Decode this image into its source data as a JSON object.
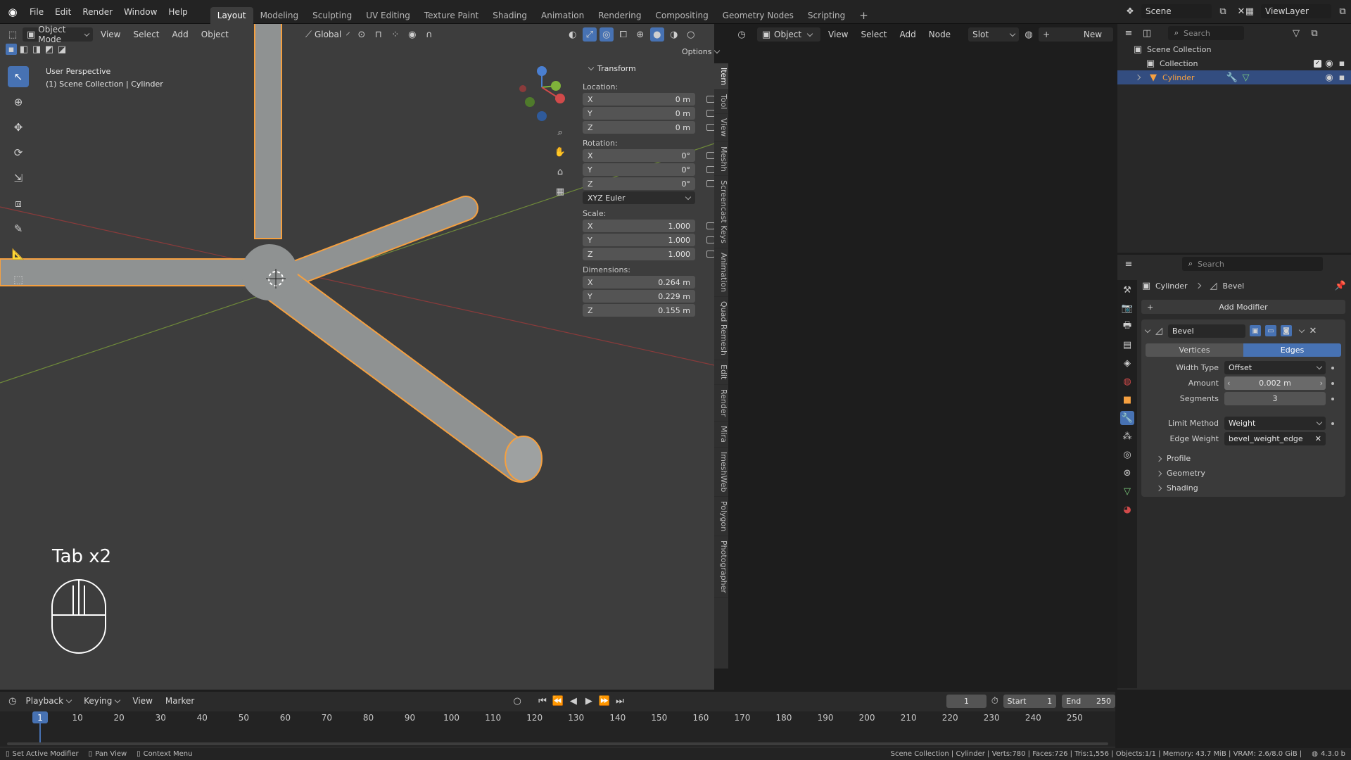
{
  "topbar": {
    "menus": [
      "File",
      "Edit",
      "Render",
      "Window",
      "Help"
    ],
    "workspaces": [
      "Layout",
      "Modeling",
      "Sculpting",
      "UV Editing",
      "Texture Paint",
      "Shading",
      "Animation",
      "Rendering",
      "Compositing",
      "Geometry Nodes",
      "Scripting"
    ],
    "active_workspace": "Layout",
    "scene": "Scene",
    "view_layer": "ViewLayer"
  },
  "viewport": {
    "mode": "Object Mode",
    "menus": [
      "View",
      "Select",
      "Add",
      "Object"
    ],
    "orientation": "Global",
    "options_label": "Options",
    "perspective_label": "User Perspective",
    "collection_label": "(1) Scene Collection | Cylinder",
    "key_hint": "Tab x2"
  },
  "npanel": {
    "section": "Transform",
    "location_label": "Location:",
    "location": [
      {
        "axis": "X",
        "value": "0 m"
      },
      {
        "axis": "Y",
        "value": "0 m"
      },
      {
        "axis": "Z",
        "value": "0 m"
      }
    ],
    "rotation_label": "Rotation:",
    "rotation": [
      {
        "axis": "X",
        "value": "0°"
      },
      {
        "axis": "Y",
        "value": "0°"
      },
      {
        "axis": "Z",
        "value": "0°"
      }
    ],
    "rotation_mode": "XYZ Euler",
    "scale_label": "Scale:",
    "scale": [
      {
        "axis": "X",
        "value": "1.000"
      },
      {
        "axis": "Y",
        "value": "1.000"
      },
      {
        "axis": "Z",
        "value": "1.000"
      }
    ],
    "dimensions_label": "Dimensions:",
    "dimensions": [
      {
        "axis": "X",
        "value": "0.264 m"
      },
      {
        "axis": "Y",
        "value": "0.229 m"
      },
      {
        "axis": "Z",
        "value": "0.155 m"
      }
    ],
    "tabs": [
      "Item",
      "Tool",
      "View",
      "Meshh",
      "Screencast Keys",
      "Animation",
      "Quad Remesh",
      "Edit",
      "Render",
      "Mira",
      "ImeshWeb",
      "Polygon",
      "Photographer"
    ]
  },
  "node_editor": {
    "type": "Object",
    "menus": [
      "View",
      "Select",
      "Add",
      "Node"
    ],
    "slot": "Slot",
    "new_label": "New"
  },
  "outliner": {
    "search_placeholder": "Search",
    "root": "Scene Collection",
    "collection": "Collection",
    "object": "Cylinder"
  },
  "properties": {
    "search_placeholder": "Search",
    "breadcrumb_object": "Cylinder",
    "breadcrumb_modifier": "Bevel",
    "add_modifier": "Add Modifier",
    "modifier_name": "Bevel",
    "affect_vertices": "Vertices",
    "affect_edges": "Edges",
    "width_type_label": "Width Type",
    "width_type": "Offset",
    "amount_label": "Amount",
    "amount": "0.002 m",
    "segments_label": "Segments",
    "segments": "3",
    "limit_method_label": "Limit Method",
    "limit_method": "Weight",
    "edge_weight_label": "Edge Weight",
    "edge_weight": "bevel_weight_edge",
    "subpanels": [
      "Profile",
      "Geometry",
      "Shading"
    ]
  },
  "timeline": {
    "menus": [
      "Playback",
      "Keying",
      "View",
      "Marker"
    ],
    "current_frame": "1",
    "start_label": "Start",
    "start": "1",
    "end_label": "End",
    "end": "250",
    "ticks": [
      "1",
      "10",
      "20",
      "30",
      "40",
      "50",
      "60",
      "70",
      "80",
      "90",
      "100",
      "110",
      "120",
      "130",
      "140",
      "150",
      "160",
      "170",
      "180",
      "190",
      "200",
      "210",
      "220",
      "230",
      "240",
      "250"
    ]
  },
  "statusbar": {
    "hint1": "Set Active Modifier",
    "hint2": "Pan View",
    "hint3": "Context Menu",
    "stats": "Scene Collection | Cylinder | Verts:780 | Faces:726 | Tris:1,556 | Objects:1/1 | Memory: 43.7 MiB | VRAM: 2.6/8.0 GiB |",
    "version": "4.3.0 b"
  }
}
